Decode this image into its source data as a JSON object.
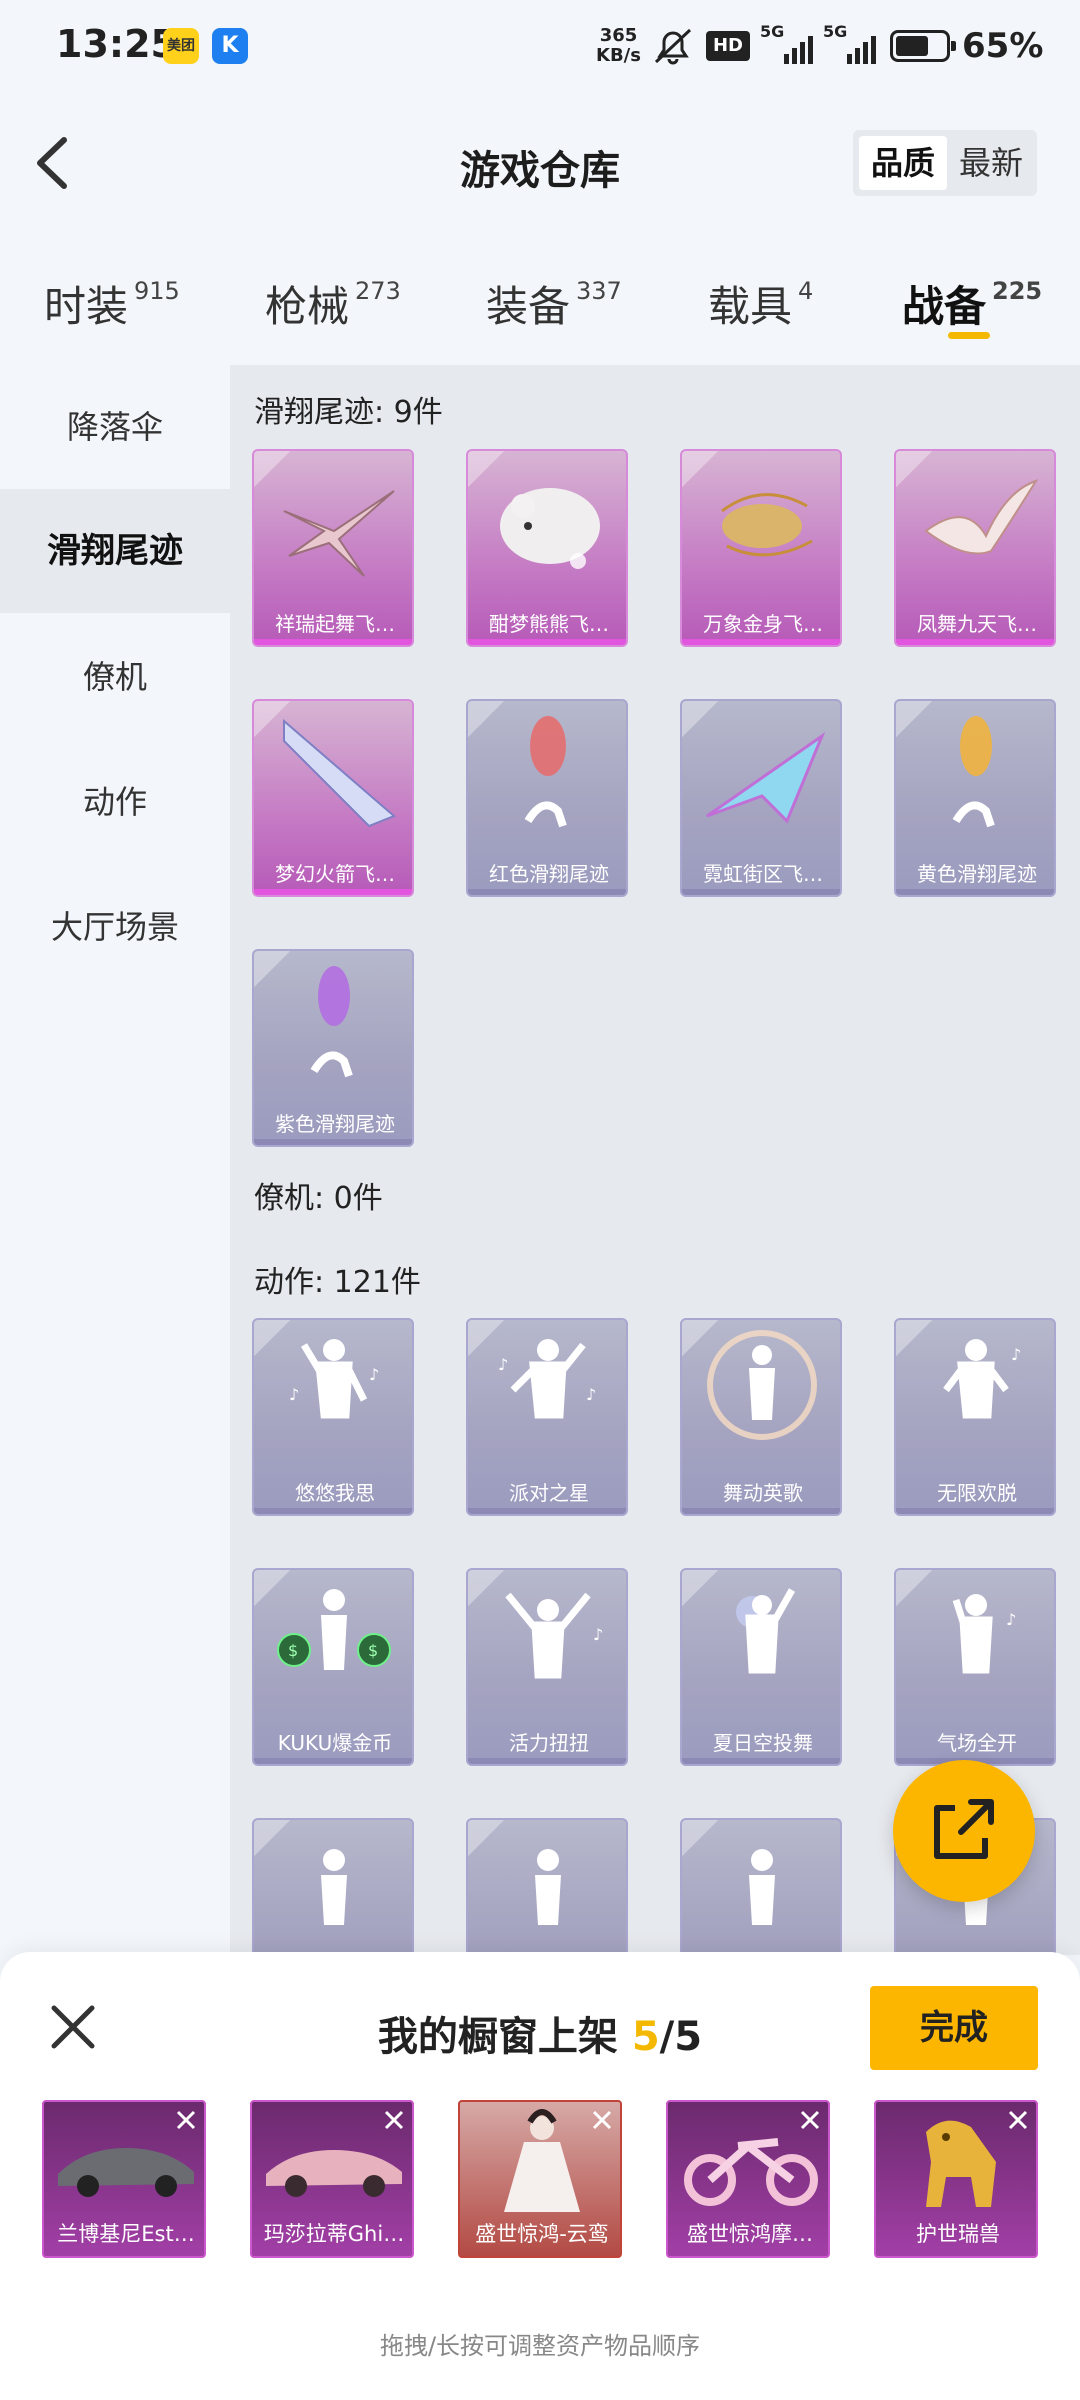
{
  "status_bar": {
    "time": "13:25",
    "app_icon_1": "美团",
    "app_icon_2": "K",
    "net_speed_value": "365",
    "net_speed_unit": "KB/s",
    "hd_badge": "HD",
    "network_1": "5G",
    "network_2": "5G",
    "battery": "65%",
    "icons": [
      "mute-icon",
      "hd-icon",
      "signal-5g-icon",
      "signal-5g-icon",
      "battery-icon"
    ]
  },
  "header": {
    "title": "游戏仓库",
    "sort_options": [
      "品质",
      "最新"
    ]
  },
  "category_tabs": [
    {
      "label": "时装",
      "count": "915"
    },
    {
      "label": "枪械",
      "count": "273"
    },
    {
      "label": "装备",
      "count": "337"
    },
    {
      "label": "载具",
      "count": "4"
    },
    {
      "label": "战备",
      "count": "225"
    }
  ],
  "sidebar": {
    "items": [
      "降落伞",
      "滑翔尾迹",
      "僚机",
      "动作",
      "大厅场景"
    ]
  },
  "sections": {
    "glide": {
      "title": "滑翔尾迹: 9件",
      "items": [
        "祥瑞起舞飞…",
        "酣梦熊熊飞…",
        "万象金身飞…",
        "凤舞九天飞…",
        "梦幻火箭飞…",
        "红色滑翔尾迹",
        "霓虹街区飞…",
        "黄色滑翔尾迹",
        "紫色滑翔尾迹"
      ]
    },
    "wingman": {
      "title": "僚机: 0件"
    },
    "action": {
      "title": "动作: 121件",
      "items": [
        "悠悠我思",
        "派对之星",
        "舞动英歌",
        "无限欢脱",
        "KUKU爆金币",
        "活力扭扭",
        "夏日空投舞",
        "气场全开"
      ]
    }
  },
  "bottom_sheet": {
    "title_prefix": "我的橱窗上架 ",
    "count_current": "5",
    "count_total": "/5",
    "done_label": "完成",
    "shelf_items": [
      "兰博基尼Est…",
      "玛莎拉蒂Ghi…",
      "盛世惊鸿-云鸾",
      "盛世惊鸿摩…",
      "护世瑞兽"
    ],
    "hint": "拖拽/长按可调整资产物品顺序"
  },
  "colors": {
    "accent": "#fdb600",
    "purple_rarity": "#c57bc4",
    "common_rarity": "#a4a3c0"
  }
}
